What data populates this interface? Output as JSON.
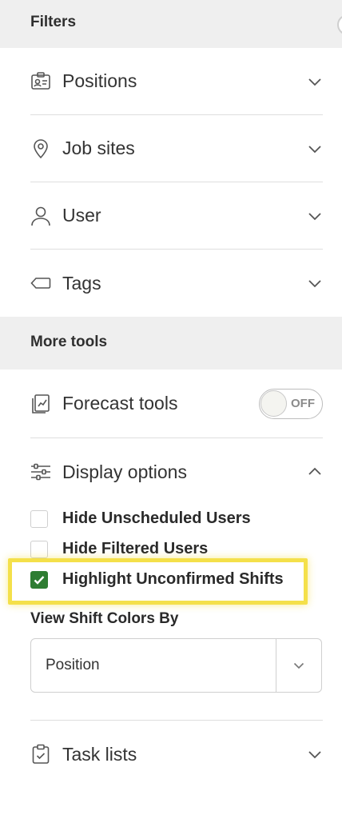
{
  "filters": {
    "title": "Filters",
    "items": [
      {
        "label": "Positions",
        "icon": "id-badge-icon"
      },
      {
        "label": "Job sites",
        "icon": "map-pin-icon"
      },
      {
        "label": "User",
        "icon": "user-icon"
      },
      {
        "label": "Tags",
        "icon": "tag-icon"
      }
    ]
  },
  "more_tools": {
    "title": "More tools",
    "forecast": {
      "label": "Forecast tools",
      "toggle_text": "OFF",
      "toggle_on": false
    },
    "display": {
      "label": "Display options",
      "expanded": true,
      "checkboxes": [
        {
          "label": "Hide Unscheduled Users",
          "checked": false
        },
        {
          "label": "Hide Filtered Users",
          "checked": false
        },
        {
          "label": "Highlight Unconfirmed Shifts",
          "checked": true
        }
      ],
      "color_by_label": "View Shift Colors By",
      "color_by_value": "Position"
    },
    "task_lists": {
      "label": "Task lists"
    }
  },
  "colors": {
    "accent": "#2e7d32",
    "highlight": "#f4e04a",
    "header_bg": "#efefef"
  }
}
